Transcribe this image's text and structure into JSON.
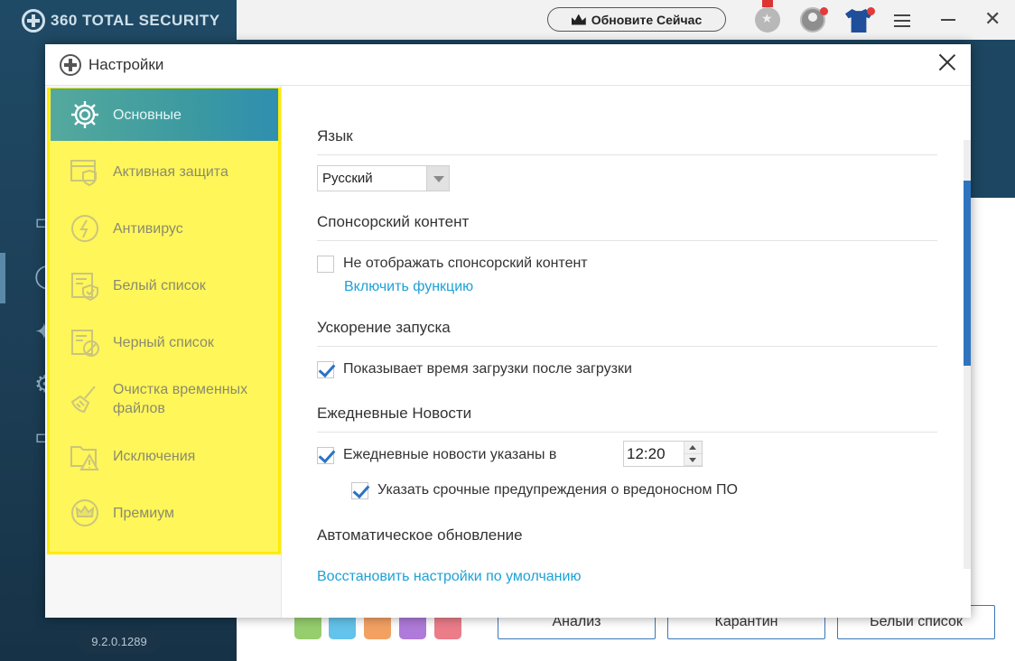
{
  "app": {
    "logo_text": "360 TOTAL SECURITY",
    "upgrade_label": "Обновите Сейчас",
    "version": "9.2.0.1289",
    "bottom_buttons": [
      "Анализ",
      "Карантин",
      "Белый список"
    ],
    "tiles": [
      {
        "icon": "cloud-icon",
        "color": "#7cc24a"
      },
      {
        "icon": "globe-icon",
        "color": "#3db4e6"
      },
      {
        "icon": "image-icon",
        "color": "#f08a3c"
      },
      {
        "icon": "b-icon",
        "color": "#9b59d0"
      },
      {
        "icon": "tools-icon",
        "color": "#e65c6b"
      }
    ]
  },
  "dialog": {
    "title": "Настройки",
    "sidebar": {
      "items": [
        {
          "label": "Основные",
          "icon": "gear-icon",
          "active": true
        },
        {
          "label": "Активная защита",
          "icon": "shield-window-icon",
          "active": false
        },
        {
          "label": "Антивирус",
          "icon": "lightning-icon",
          "active": false
        },
        {
          "label": "Белый список",
          "icon": "whitelist-icon",
          "active": false
        },
        {
          "label": "Черный список",
          "icon": "blacklist-icon",
          "active": false
        },
        {
          "label": "Очистка временных файлов",
          "icon": "broom-icon",
          "active": false
        },
        {
          "label": "Исключения",
          "icon": "folder-warning-icon",
          "active": false
        },
        {
          "label": "Премиум",
          "icon": "crown-icon",
          "active": false
        }
      ]
    },
    "content": {
      "language": {
        "title": "Язык",
        "value": "Русский"
      },
      "sponsored": {
        "title": "Спонсорский контент",
        "option_label": "Не отображать спонсорский контент",
        "option_checked": false,
        "enable_link": "Включить функцию"
      },
      "startup": {
        "title": "Ускорение запуска",
        "option_label": "Показывает время загрузки после загрузки",
        "option_checked": true
      },
      "daily_news": {
        "title": "Ежедневные Новости",
        "option_label": "Ежедневные новости указаны в",
        "option_checked": true,
        "time": "12:20",
        "sub_option_label": "Указать срочные предупреждения о вредоносном ПО",
        "sub_option_checked": true
      },
      "auto_update": {
        "title": "Автоматическое обновление"
      },
      "restore_link": "Восстановить настройки по умолчанию"
    }
  },
  "colors": {
    "highlight": "#fff65a",
    "active_item": "#3c9aa0",
    "link": "#1fa1d6",
    "check": "#2b73c5"
  }
}
